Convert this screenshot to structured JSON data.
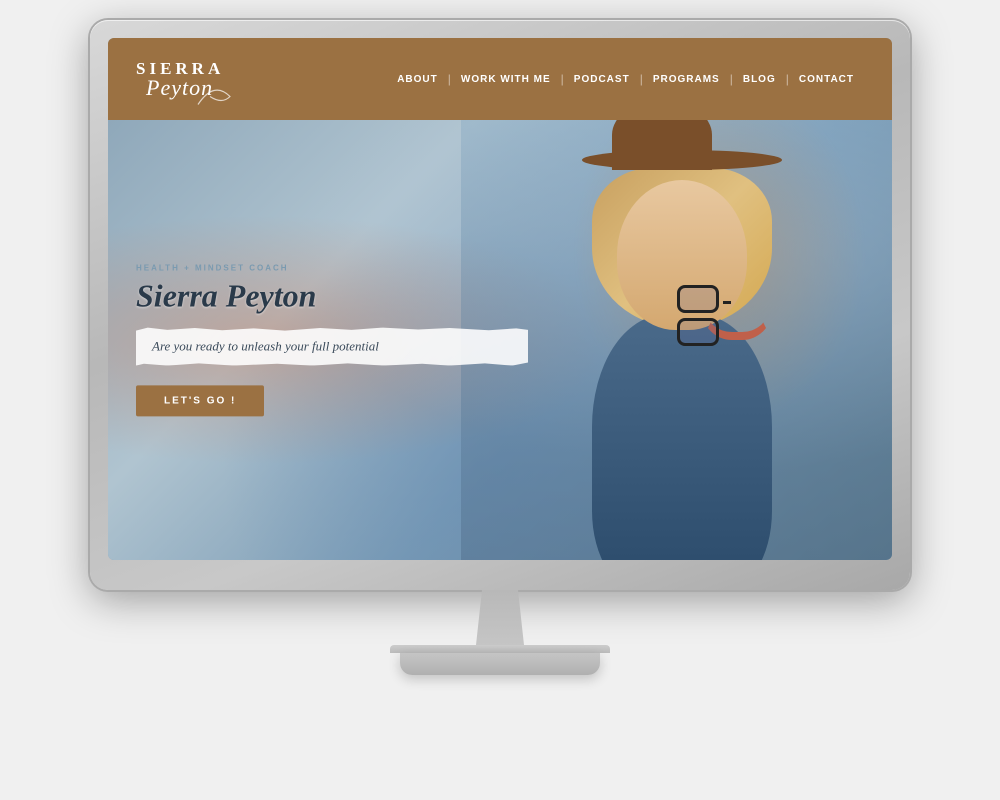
{
  "monitor": {
    "label": "iMac monitor mockup"
  },
  "website": {
    "header": {
      "logo": {
        "line1": "SIERRA",
        "line2": "Peyton"
      },
      "nav": {
        "items": [
          {
            "label": "ABOUT",
            "id": "about"
          },
          {
            "label": "WORK WITH ME",
            "id": "work-with-me"
          },
          {
            "label": "PODCAST",
            "id": "podcast"
          },
          {
            "label": "PROGRAMS",
            "id": "programs"
          },
          {
            "label": "BLOG",
            "id": "blog"
          },
          {
            "label": "CONTACT",
            "id": "contact"
          }
        ]
      }
    },
    "hero": {
      "tagline": "HEALTH + MINDSET COACH",
      "name": "Sierra Peyton",
      "subheadline": "Are you ready to unleash your full potential",
      "cta_label": "LET'S GO !"
    }
  }
}
